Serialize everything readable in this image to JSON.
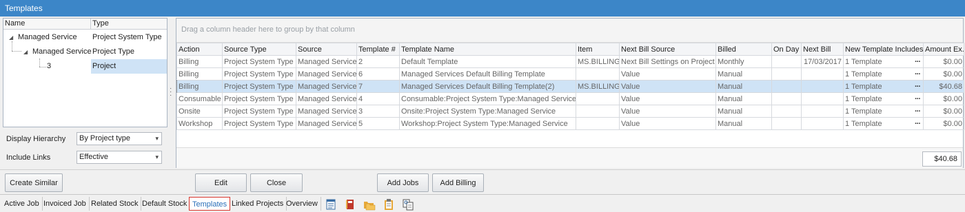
{
  "window": {
    "title": "Templates"
  },
  "tree": {
    "columns": [
      "Name",
      "Type"
    ],
    "rows": [
      {
        "name": "Managed Service",
        "type": "Project System Type"
      },
      {
        "name": "Managed Service",
        "type": "Project Type"
      },
      {
        "name": "3",
        "type": "Project"
      }
    ]
  },
  "options": {
    "display_hierarchy_label": "Display Hierarchy",
    "display_hierarchy_value": "By Project type",
    "include_links_label": "Include Links",
    "include_links_value": "Effective"
  },
  "grid": {
    "group_hint": "Drag a column header here to group by that column",
    "columns": [
      "Action",
      "Source Type",
      "Source",
      "Template #",
      "Template Name",
      "Item",
      "Next Bill Source",
      "Billed",
      "On Day",
      "Next Bill",
      "New Template Includes",
      "Amount Ex."
    ],
    "rows": [
      [
        "Billing",
        "Project System Type",
        "Managed Service",
        "2",
        "Default Template",
        "MS.BILLING",
        "Next Bill Settings on Project",
        "Monthly",
        "",
        "17/03/2017",
        "1 Template",
        "$0.00"
      ],
      [
        "Billing",
        "Project System Type",
        "Managed Service",
        "6",
        "Managed Services Default Billing Template",
        "",
        "Value",
        "Manual",
        "",
        "",
        "1 Template",
        "$0.00"
      ],
      [
        "Billing",
        "Project System Type",
        "Managed Service",
        "7",
        "Managed Services Default Billing Template(2)",
        "MS.BILLING",
        "Value",
        "Manual",
        "",
        "",
        "1 Template",
        "$40.68"
      ],
      [
        "Consumable",
        "Project System Type",
        "Managed Service",
        "4",
        "Consumable:Project System Type:Managed Service",
        "",
        "Value",
        "Manual",
        "",
        "",
        "1 Template",
        "$0.00"
      ],
      [
        "Onsite",
        "Project System Type",
        "Managed Service",
        "3",
        "Onsite:Project System Type:Managed Service",
        "",
        "Value",
        "Manual",
        "",
        "",
        "1 Template",
        "$0.00"
      ],
      [
        "Workshop",
        "Project System Type",
        "Managed Service",
        "5",
        "Workshop:Project System Type:Managed Service",
        "",
        "Value",
        "Manual",
        "",
        "",
        "1 Template",
        "$0.00"
      ]
    ],
    "selected_row": 2,
    "total": "$40.68"
  },
  "buttons": {
    "create_similar": "Create Similar",
    "edit": "Edit",
    "close": "Close",
    "add_jobs": "Add Jobs",
    "add_billing": "Add Billing"
  },
  "tabs": [
    "Active Job",
    "Invoiced Job",
    "Related Stock",
    "Default Stock",
    "Templates",
    "Linked Projects",
    "Overview"
  ],
  "active_tab": "Templates",
  "toolbar_icons": [
    "form-icon",
    "book-icon",
    "folders-icon",
    "clipboard-icon",
    "documents-icon"
  ],
  "colors": {
    "titlebar": "#3c86c8",
    "selection": "#cfe3f6",
    "active_tab_border": "#d9342b"
  }
}
